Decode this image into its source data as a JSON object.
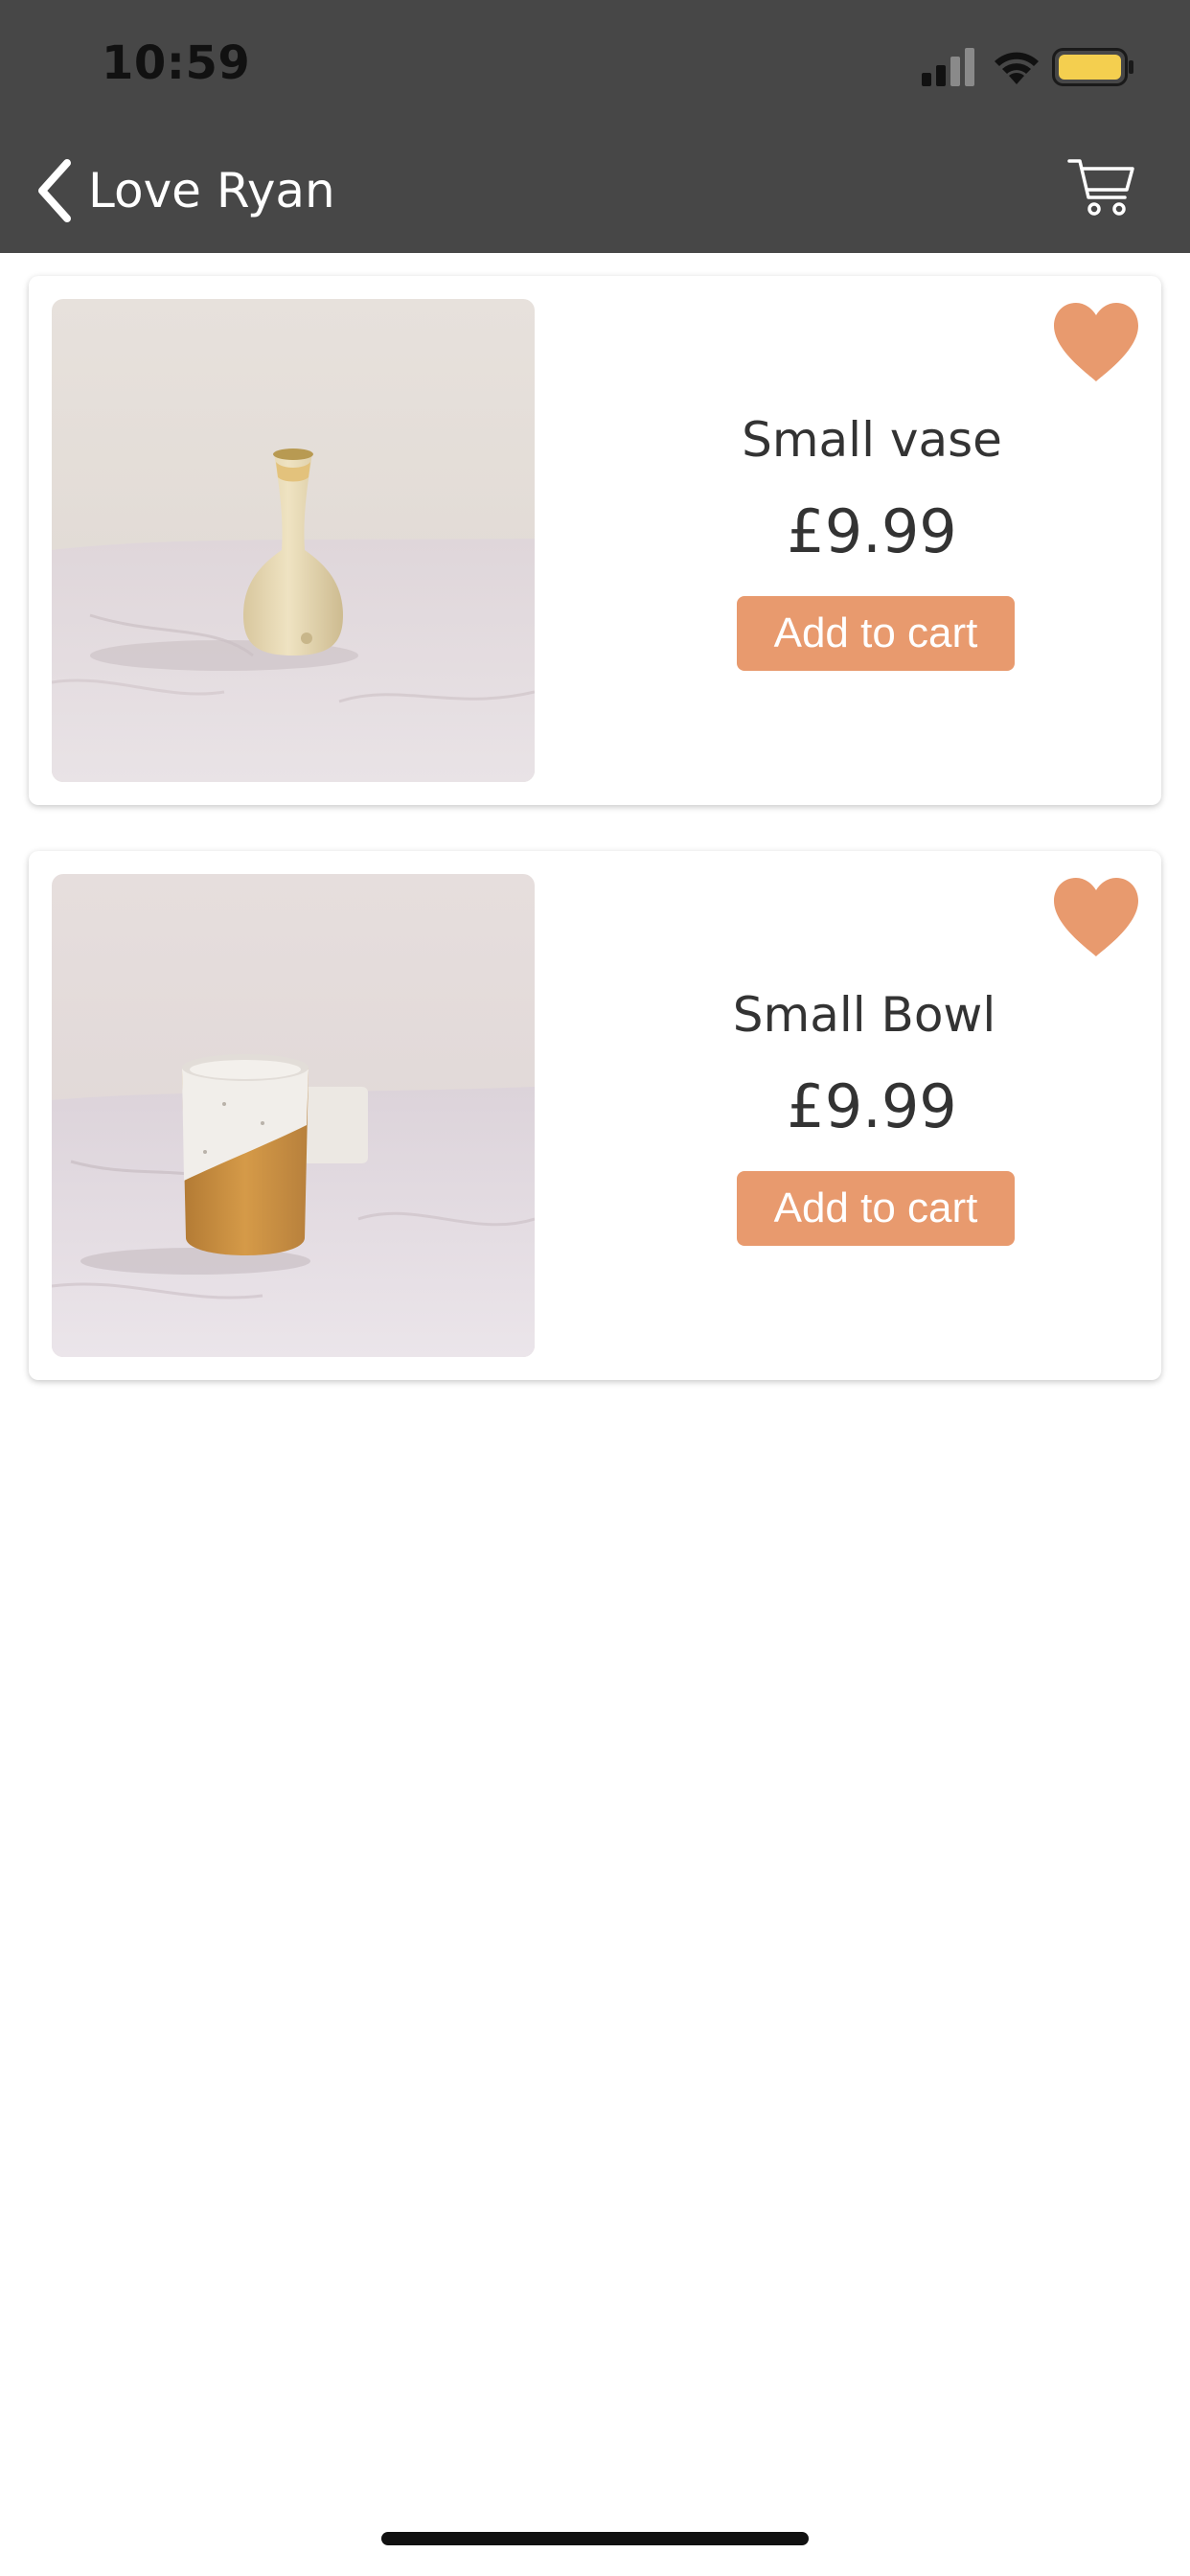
{
  "status_bar": {
    "time": "10:59"
  },
  "nav": {
    "back_label": "Love Ryan",
    "cart_icon": "cart-icon"
  },
  "colors": {
    "accent": "#e89a6e",
    "header": "#474747",
    "text": "#333333"
  },
  "products": [
    {
      "name": "Small vase",
      "price": "£9.99",
      "button_label": "Add to cart",
      "favorited": true,
      "image": "cream-ceramic-vase-photo"
    },
    {
      "name": "Small Bowl",
      "price": "£9.99",
      "button_label": "Add to cart",
      "favorited": true,
      "image": "white-and-ochre-ceramic-cup-photo"
    }
  ]
}
